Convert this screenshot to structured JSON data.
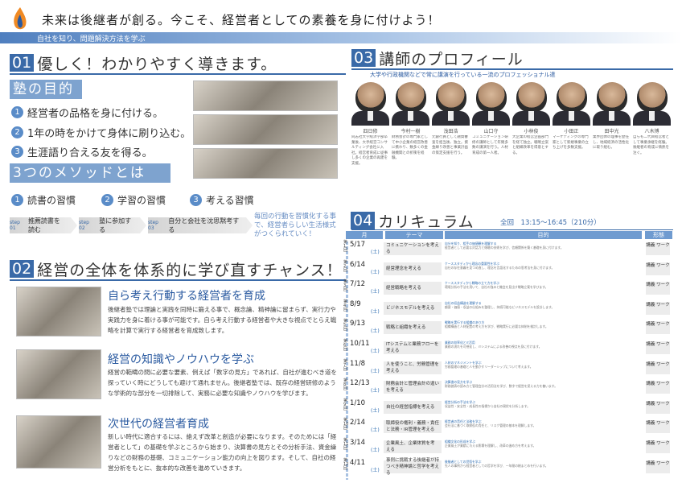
{
  "header": {
    "headline": "未来は後継者が創る。今こそ、経営者としての素養を身に付けよう！",
    "subbar": "自社を知り、問題解決方法を学ぶ"
  },
  "section01": {
    "num": "01",
    "title": "優しく！わかりやすく導きます。",
    "purpose_title": "塾の目的",
    "goals": [
      {
        "num": "1",
        "text": "経営者の品格を身に付ける。"
      },
      {
        "num": "2",
        "text": "1年の時をかけて身体に刷り込む。"
      },
      {
        "num": "3",
        "text": "生涯語り合える友を得る。"
      }
    ],
    "method_title": "3つのメソッドとは",
    "habits": [
      {
        "num": "1",
        "text": "読書の習慣"
      },
      {
        "num": "2",
        "text": "学習の習慣"
      },
      {
        "num": "3",
        "text": "考える習慣"
      }
    ],
    "steps": [
      {
        "tag": "step 01",
        "text": "推薦読書を読む"
      },
      {
        "tag": "step 02",
        "text": "塾に参加する"
      },
      {
        "tag": "step 03",
        "text": "自分と会社を沈思黙考する"
      }
    ],
    "step_note": "毎回の行動を習慣化する事で、経営者らしい生活様式がつくられていく！"
  },
  "section02": {
    "num": "02",
    "title": "経営の全体を体系的に学び直すチャンス！",
    "blocks": [
      {
        "title": "自ら考え行動する経営者を育成",
        "text": "後継者塾では理論と実践を同時に鍛える事で、概念論、精神論に留まらず、実行力や実践力を身に着ける事が可能です。自ら考え行動する経営者や大きな視点でとらえ戦略を計算で実行する経営者を育成致します。"
      },
      {
        "title": "経営の知識やノウハウを学ぶ",
        "text": "経営の範疇の問に必要な要素、例えば「数字の見方」であれば、自社が進むべき道を探っていく時にどうしても避けて通れません。後継者塾では、既存の経営研修のような学術的な部分を一切排除して、実務に必要な知識やノウハウを学びます。"
      },
      {
        "title": "次世代の経営者育成",
        "text": "新しい時代に適合するには、絶えず改革と創造が必要になります。そのためには「経営者として」の基礎を学ぶところから始まり、決算書の見方とその分析手法、資金繰りなどの財務の基礎、コミュニケーション能力の向上を図ります。そして、自社の経営分析をもとに、抜本的な改善を進めていきます。"
      }
    ]
  },
  "section03": {
    "num": "03",
    "title": "講師のプロフィール",
    "subtitle": "大学や行政機関などで常に講演を行っている一流のプロフェッショナル達",
    "teachers": [
      {
        "name": "四日修",
        "bio": "同志社大学経済学部卒業後、大手経営コンサルティング会社に入社。経営者育成に従事し多くの企業の再建を支援。"
      },
      {
        "name": "今村一樹",
        "bio": "財務会計の専門家として中小企業の経営改善に携わり、数多くの金融機関との折衝を経験。"
      },
      {
        "name": "浅田浩",
        "bio": "元銀行員として融資審査を担当後、独立。資金繰り改善と事業計画の策定支援を行う。"
      },
      {
        "name": "山口守",
        "bio": "コミュニケーション研修の講師として年間多数の講演を行う。人材育成の第一人者。"
      },
      {
        "name": "小林俊",
        "bio": "大企業の経営企画部門を経て独立。戦略立案と組織改革を得意とする。"
      },
      {
        "name": "小田正",
        "bio": "マーケティングの専門家として新規事業の立ち上げを多数支援。"
      },
      {
        "name": "田中光",
        "bio": "業界団体の理事を歴任し、地域経済の活性化に取り組む。"
      },
      {
        "name": "八木博",
        "bio": "自らも二代目経営者として事業承継を経験。後継者の育成に情熱を注ぐ。"
      }
    ]
  },
  "section04": {
    "num": "04",
    "title": "カリキュラム",
    "time_label": "全回",
    "time_value": "13:15～16:45（210分）",
    "columns": [
      "月",
      "テーマ",
      "目的",
      "形態"
    ],
    "rows": [
      {
        "n": "第1回",
        "date": "5/17",
        "dow": "(土)",
        "theme": "コミュニケーションを考える",
        "desc_title": "自分を知り、相手の価値観を理解する",
        "desc": "経営者として必要な対話力と傾聴の技術を学び、信頼関係を築く基礎を身に付けます。",
        "form": "講義 ワーク"
      },
      {
        "n": "第2回",
        "date": "6/14",
        "dow": "(土)",
        "theme": "経営理念を考える",
        "desc_title": "ケーススタディから理念の重要性を学ぶ",
        "desc": "自社の存在意義を見つめ直し、理念を言語化するための思考法を身に付けます。",
        "form": "講義 ワーク"
      },
      {
        "n": "第3回",
        "date": "7/12",
        "dow": "(土)",
        "theme": "経営戦略を考える",
        "desc_title": "ケーススタディから戦略の立て方を学ぶ",
        "desc": "環境分析の手法を用いて、自社の強みと機会を見出す戦略立案を学びます。",
        "form": "講義 ワーク"
      },
      {
        "n": "第4回",
        "date": "8/9",
        "dow": "(土)",
        "theme": "ビジネスモデルを考える",
        "desc_title": "自社の収益構造を理解する",
        "desc": "顧客・価値・収益の仕組みを整理し、持続可能なビジネスモデルを設計します。",
        "form": "講義 ワーク"
      },
      {
        "n": "第5回",
        "date": "9/13",
        "dow": "(土)",
        "theme": "戦略と組織を考える",
        "desc_title": "戦略を実行する組織のあり方",
        "desc": "組織構造と人材配置の考え方を学び、戦略実行に必要な体制を検討します。",
        "form": "講義 ワーク"
      },
      {
        "n": "第6回",
        "date": "10/11",
        "dow": "(土)",
        "theme": "ITシステムと業務フローを考える",
        "desc_title": "業務の効率化とIT活用",
        "desc": "業務の流れを可視化し、ITシステムによる改善の視点を身に付けます。",
        "form": "講義 ワーク"
      },
      {
        "n": "第7回",
        "date": "11/8",
        "dow": "(土)",
        "theme": "人を使うこと、労務管理を考える",
        "desc_title": "人材のマネジメントを学ぶ",
        "desc": "労務管理の基礎と人を動かすリーダーシップについて考えます。",
        "form": "講義 ワーク"
      },
      {
        "n": "第8回",
        "date": "12/13",
        "dow": "(土)",
        "theme": "財務会計と管理会計の違いを考える",
        "desc_title": "決算書の見方を学ぶ",
        "desc": "財務諸表の読み方と管理会計の活用法を学び、数字で経営を捉える力を養います。",
        "form": "講義 ワーク"
      },
      {
        "n": "第9回",
        "date": "1/10",
        "dow": "(土)",
        "theme": "自社の経営指標を考える",
        "desc_title": "経営分析の手法を学ぶ",
        "desc": "収益性・安全性・成長性の指標から自社の現状を分析します。",
        "form": "講義 ワーク"
      },
      {
        "n": "第10回",
        "date": "2/14",
        "dow": "(土)",
        "theme": "取締役の権利・義務・責任と法務・IR管理を考える",
        "desc_title": "経営者の責任と法務を学ぶ",
        "desc": "会社法に基づく取締役の責任と、リスク管理の基本を理解します。",
        "form": "講義 ワーク"
      },
      {
        "n": "第11回",
        "date": "3/14",
        "dow": "(土)",
        "theme": "企業風土、企業体質を考える",
        "desc_title": "組織文化の形成を学ぶ",
        "desc": "企業風土が業績に与える影響を理解し、改革の進め方を考えます。",
        "form": "講義 ワーク"
      },
      {
        "n": "第12回",
        "date": "4/11",
        "dow": "(土)",
        "theme": "事例に挑戦する後継者が持つべき精神論と哲学を考える",
        "desc_title": "後継者としての覚悟を学ぶ",
        "desc": "先人の事例から経営者としての哲学を学び、一年間の総まとめを行います。",
        "form": "講義 ワーク"
      }
    ]
  }
}
